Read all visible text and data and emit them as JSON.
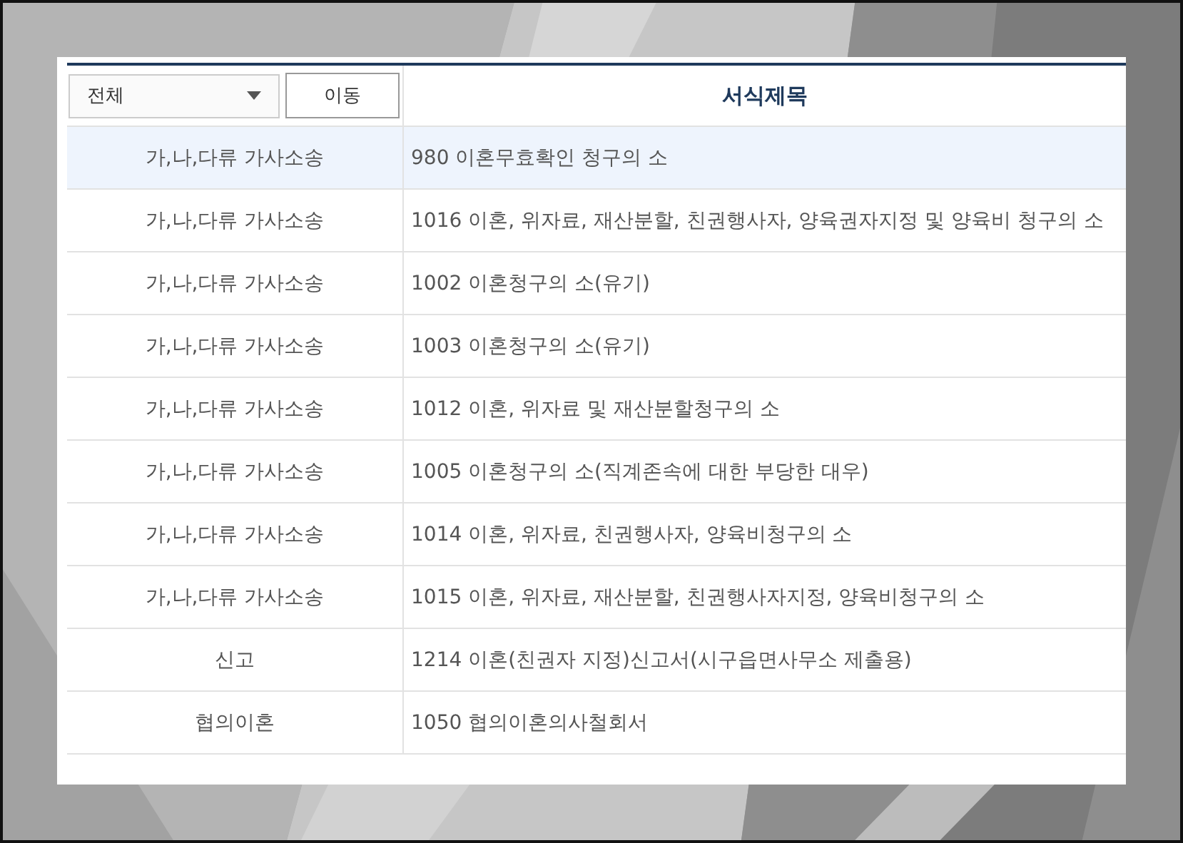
{
  "filter": {
    "value": "전체"
  },
  "move_button": "이동",
  "table": {
    "columns": [
      "서식제목"
    ],
    "rows": [
      {
        "category": "가,나,다류 가사소송",
        "title": "980 이혼무효확인 청구의 소",
        "selected": true
      },
      {
        "category": "가,나,다류 가사소송",
        "title": "1016 이혼, 위자료, 재산분할, 친권행사자, 양육권자지정 및 양육비 청구의 소",
        "selected": false
      },
      {
        "category": "가,나,다류 가사소송",
        "title": "1002 이혼청구의 소(유기)",
        "selected": false
      },
      {
        "category": "가,나,다류 가사소송",
        "title": "1003 이혼청구의 소(유기)",
        "selected": false
      },
      {
        "category": "가,나,다류 가사소송",
        "title": "1012 이혼, 위자료 및 재산분할청구의 소",
        "selected": false
      },
      {
        "category": "가,나,다류 가사소송",
        "title": "1005 이혼청구의 소(직계존속에 대한 부당한 대우)",
        "selected": false
      },
      {
        "category": "가,나,다류 가사소송",
        "title": "1014 이혼, 위자료, 친권행사자, 양육비청구의 소",
        "selected": false
      },
      {
        "category": "가,나,다류 가사소송",
        "title": "1015 이혼, 위자료, 재산분할, 친권행사자지정, 양육비청구의 소",
        "selected": false
      },
      {
        "category": "신고",
        "title": "1214 이혼(친권자 지정)신고서(시구읍면사무소 제출용)",
        "selected": false
      },
      {
        "category": "협의이혼",
        "title": "1050 협의이혼의사철회서",
        "selected": false
      }
    ]
  }
}
